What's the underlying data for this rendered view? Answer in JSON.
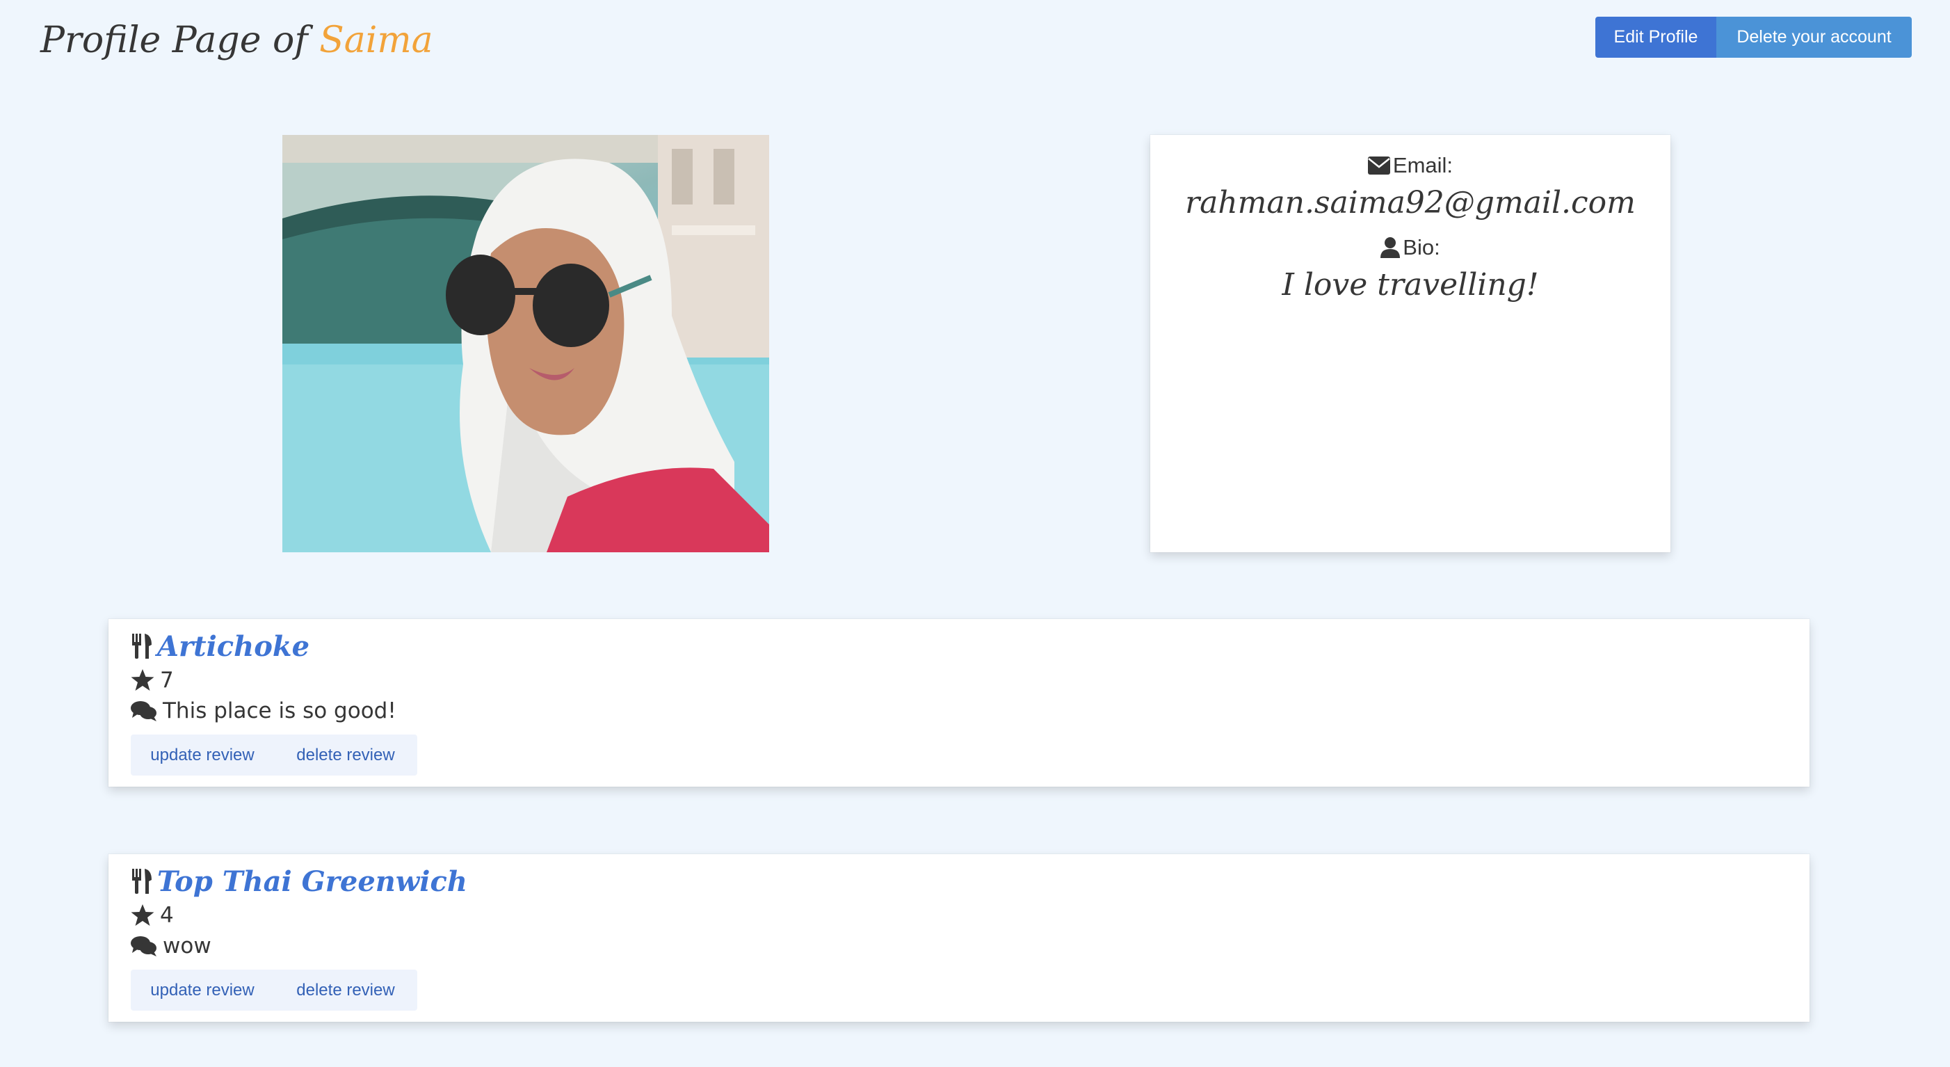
{
  "header": {
    "title_prefix": "Profile Page of",
    "user_name": "Saima",
    "edit_profile_label": "Edit Profile",
    "delete_account_label": "Delete your account"
  },
  "profile": {
    "email_label": "Email:",
    "email": "rahman.saima92@gmail.com",
    "bio_label": "Bio:",
    "bio": "I love travelling!"
  },
  "reviews": [
    {
      "restaurant": "Artichoke",
      "rating": "7",
      "comment": "This place is so good!",
      "update_label": "update review",
      "delete_label": "delete review"
    },
    {
      "restaurant": "Top Thai Greenwich",
      "rating": "4",
      "comment": "wow",
      "update_label": "update review",
      "delete_label": "delete review"
    }
  ],
  "icons": {
    "email": "envelope-icon",
    "bio": "user-icon",
    "restaurant": "utensils-icon",
    "rating": "star-icon",
    "comment": "comments-icon"
  },
  "colors": {
    "background": "#eff6fd",
    "accent_name": "#f2a33a",
    "primary_button": "#3e74d4",
    "secondary_button": "#4b93d7",
    "link": "#3e74d4"
  }
}
